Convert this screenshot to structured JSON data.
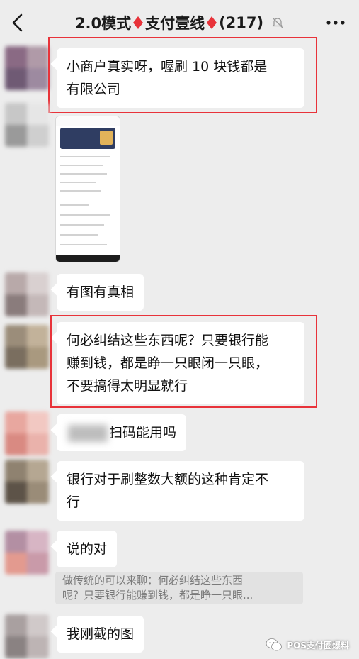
{
  "header": {
    "title_prefix": "2.0模式",
    "title_middle": "支付壹线",
    "member_count": "(217)",
    "back_icon": "chevron-left-icon",
    "mute_icon": "bell-muted-icon",
    "more_icon": "more-dots-icon"
  },
  "messages": [
    {
      "type": "text",
      "text_line1": "小商户真实呀，喔刷 10 块钱都是",
      "text_line2": "有限公司",
      "highlighted": true
    },
    {
      "type": "image",
      "description_icon": "screenshot-thumbnail"
    },
    {
      "type": "text",
      "text_line1": "有图有真相"
    },
    {
      "type": "text",
      "text_line1": "何必纠结这些东西呢？只要银行能",
      "text_line2": "赚到钱，都是睁一只眼闭一只眼，",
      "text_line3": "不要搞得太明显就行",
      "highlighted": true
    },
    {
      "type": "text",
      "text_visible": "扫码能用吗",
      "has_redaction": true
    },
    {
      "type": "text",
      "text_line1": "银行对于刷整数大额的这种肯定不",
      "text_line2": "行"
    },
    {
      "type": "text",
      "text_line1": "说的对"
    },
    {
      "type": "quote",
      "text_line1": "做传统的可以来聊：何必纠结这些东西",
      "text_line2": "呢？只要银行能赚到钱，都是睁一只眼..."
    },
    {
      "type": "text",
      "text_line1": "我刚截的图"
    }
  ],
  "watermark": {
    "text": "POS支付圈爆料",
    "icon": "wechat-icon"
  },
  "colors": {
    "background": "#ededed",
    "bubble": "#ffffff",
    "highlight_border": "#e8333a",
    "diamond": "#e8333a"
  }
}
